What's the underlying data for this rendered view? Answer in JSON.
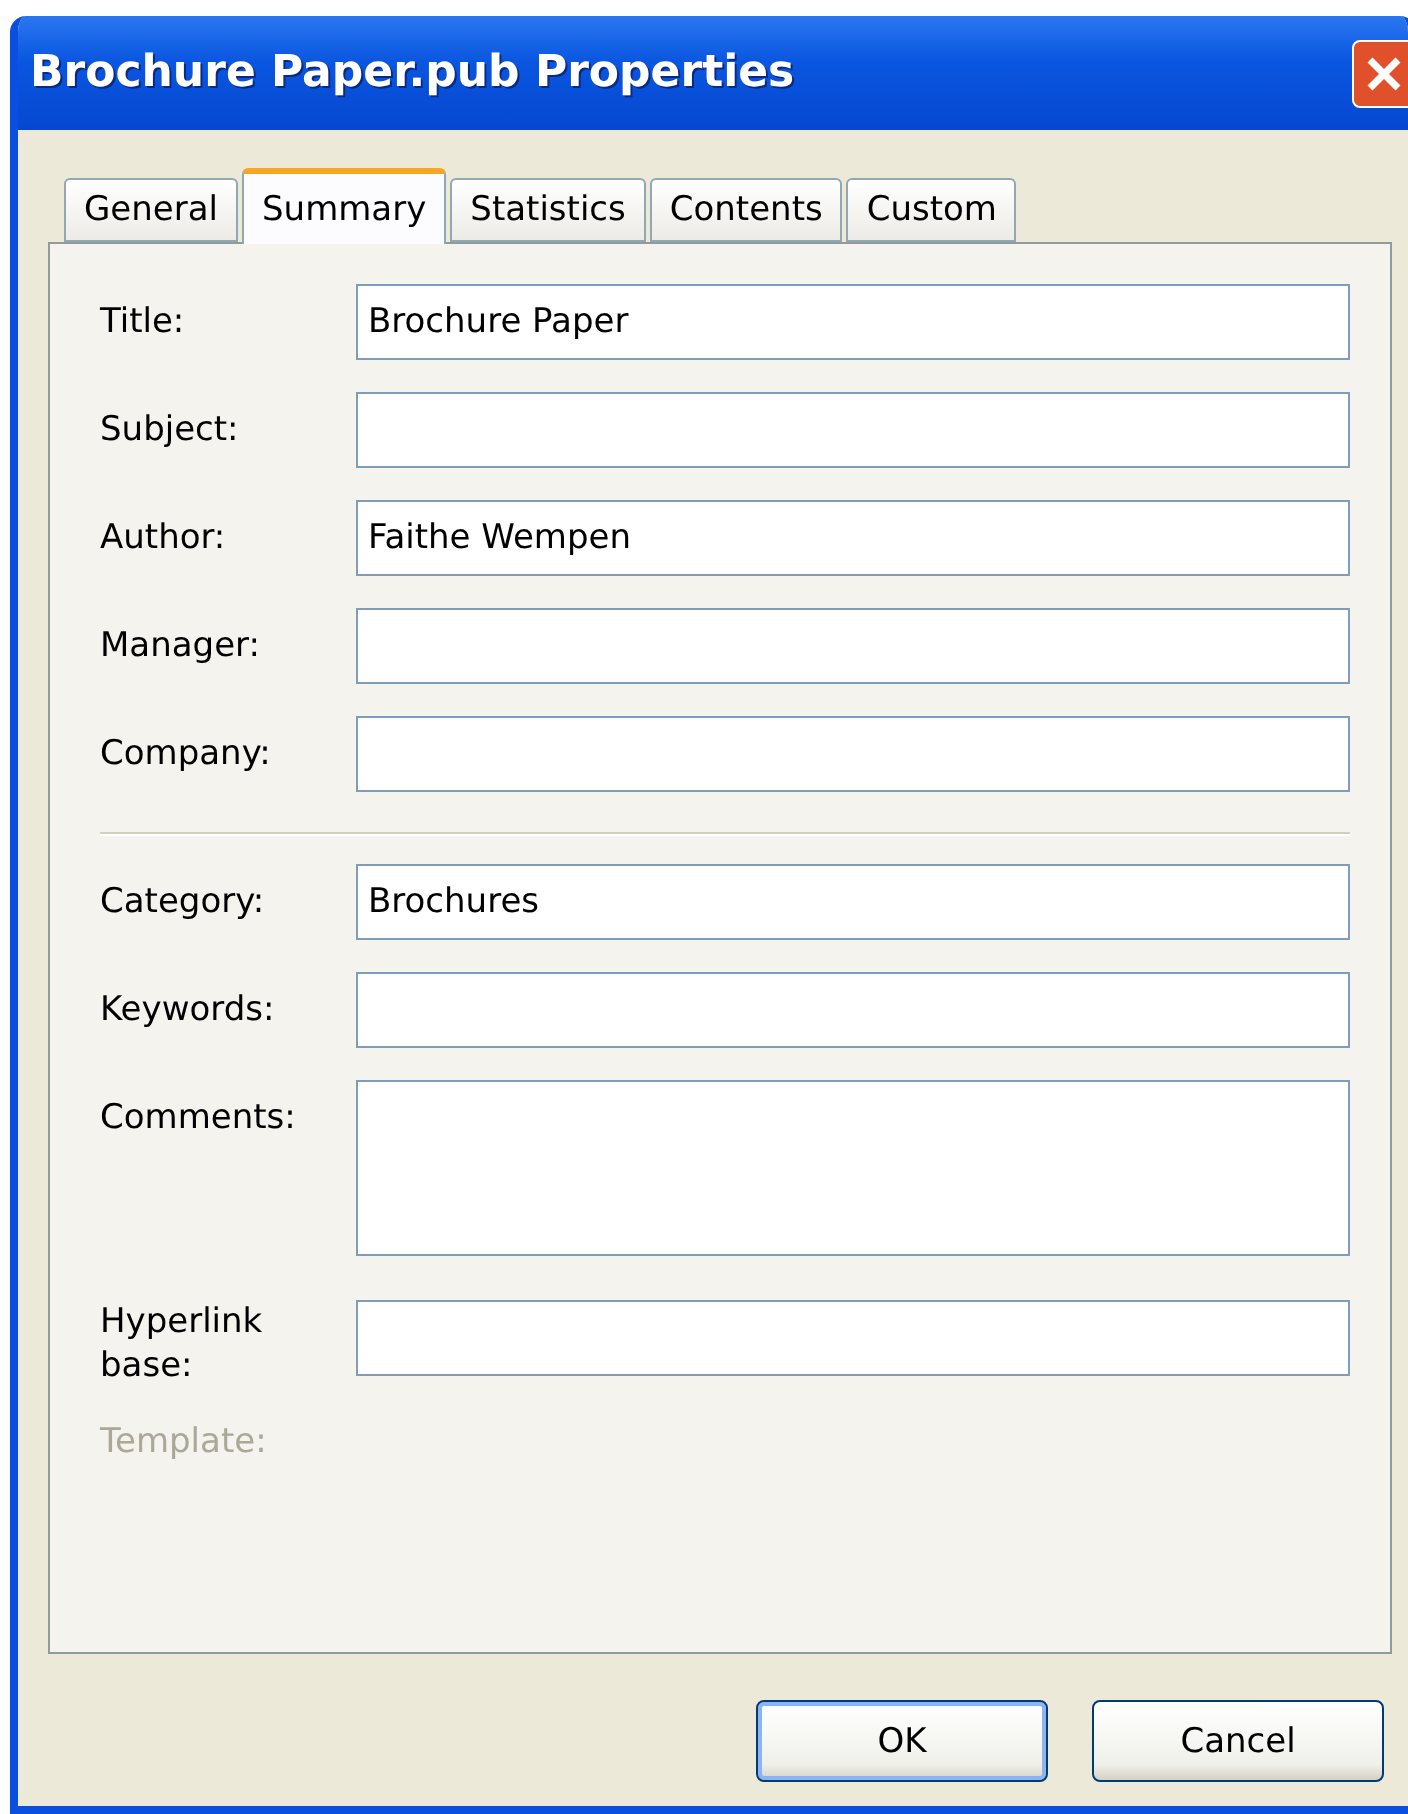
{
  "window": {
    "title": "Brochure Paper.pub Properties"
  },
  "tabs": [
    {
      "label": "General",
      "selected": false
    },
    {
      "label": "Summary",
      "selected": true
    },
    {
      "label": "Statistics",
      "selected": false
    },
    {
      "label": "Contents",
      "selected": false
    },
    {
      "label": "Custom",
      "selected": false
    }
  ],
  "fields_top": [
    {
      "kind": "text",
      "label": "Title:",
      "value": "Brochure Paper"
    },
    {
      "kind": "text",
      "label": "Subject:"
    },
    {
      "kind": "text",
      "label": "Author:",
      "value": "Faithe Wempen"
    },
    {
      "kind": "text",
      "label": "Manager:"
    },
    {
      "kind": "text",
      "label": "Company:"
    }
  ],
  "fields_bottom": [
    {
      "kind": "text",
      "label": "Category:",
      "value": "Brochures"
    },
    {
      "kind": "text",
      "label": "Keywords:"
    },
    {
      "kind": "multiline",
      "label": "Comments:"
    },
    {
      "kind": "text",
      "label": "Hyperlink base:"
    },
    {
      "kind": "static",
      "label": "Template:",
      "disabled": true
    }
  ],
  "buttons": [
    {
      "label": "OK",
      "default": true
    },
    {
      "label": "Cancel",
      "default": false
    }
  ]
}
